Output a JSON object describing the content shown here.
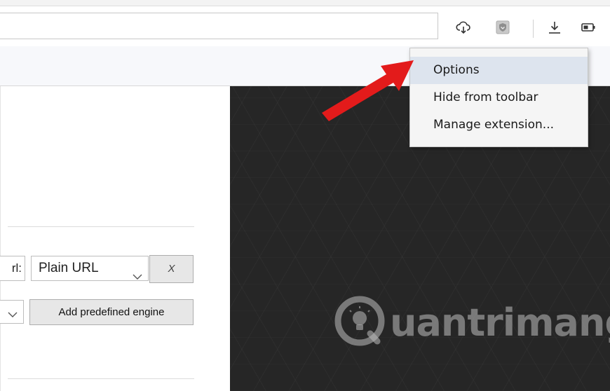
{
  "context_menu": {
    "items": [
      {
        "label": "Options",
        "active": true
      },
      {
        "label": "Hide from toolbar",
        "active": false
      },
      {
        "label": "Manage extension...",
        "active": false
      }
    ]
  },
  "options_page": {
    "url_label_fragment": "rl:",
    "url_type_select": "Plain URL",
    "remove_button": "X",
    "add_engine_button": "Add predefined engine"
  },
  "toolbar": {
    "icons": [
      "cloud-download-icon",
      "extension-shield-icon",
      "download-icon",
      "battery-icon"
    ]
  },
  "watermark": {
    "text": "uantrimang"
  },
  "colors": {
    "menu_highlight": "#dde4ee",
    "arrow_red": "#e31b1b",
    "dark_panel": "#262626"
  }
}
